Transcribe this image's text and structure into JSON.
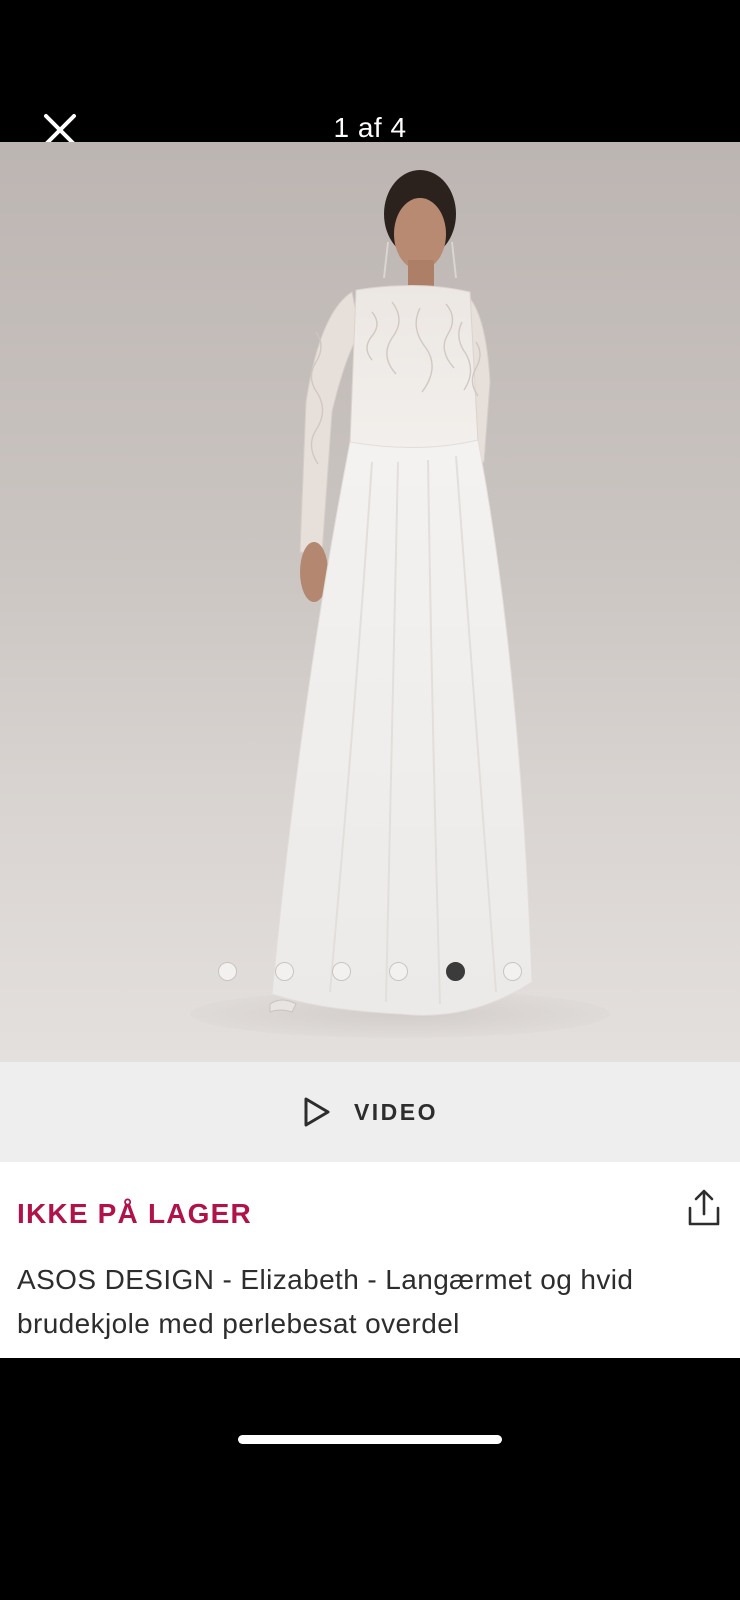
{
  "viewer": {
    "counter": "1 af 4",
    "close_icon": "close-icon"
  },
  "gallery": {
    "dots_count": 6,
    "active_dot_index": 4
  },
  "video": {
    "label": "VIDEO",
    "icon": "play-icon"
  },
  "product": {
    "stock_status": "IKKE PÅ LAGER",
    "title": "ASOS DESIGN - Elizabeth - Langærmet og hvid brudekjole med perlebesat overdel",
    "share_icon": "share-icon"
  },
  "colors": {
    "stock_accent": "#b0124a",
    "background": "#000000",
    "video_bar": "#eeeeee"
  }
}
